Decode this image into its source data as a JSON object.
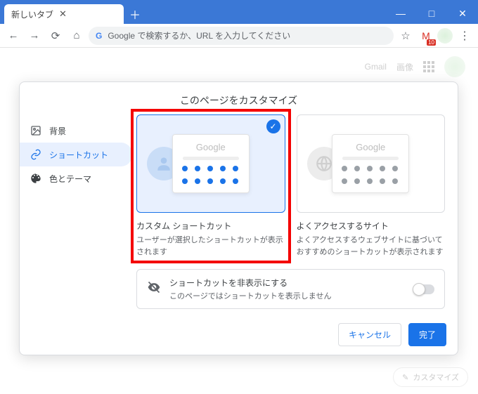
{
  "window": {
    "tab_title": "新しいタブ"
  },
  "toolbar": {
    "omnibox_placeholder": "Google で検索するか、URL を入力してください",
    "gmail_badge": "10"
  },
  "ntp": {
    "gmail": "Gmail",
    "images": "画像",
    "customize_fab": "カスタマイズ"
  },
  "dialog": {
    "title": "このページをカスタマイズ",
    "sidebar": {
      "background": "背景",
      "shortcuts": "ショートカット",
      "theme": "色とテーマ"
    },
    "cards": {
      "custom": {
        "logo": "Google",
        "title": "カスタム ショートカット",
        "desc": "ユーザーが選択したショートカットが表示されます"
      },
      "most": {
        "logo": "Google",
        "title": "よくアクセスするサイト",
        "desc": "よくアクセスするウェブサイトに基づいておすすめのショートカットが表示されます"
      }
    },
    "hide": {
      "title": "ショートカットを非表示にする",
      "desc": "このページではショートカットを表示しません"
    },
    "footer": {
      "cancel": "キャンセル",
      "done": "完了"
    }
  },
  "colors": {
    "dot_selected": "#1a73e8",
    "dot_grey": "#9aa0a6",
    "logo_grey": "#bdbdbd",
    "ghost_blue": "#c9ddf7",
    "ghost_grey": "#e4e4e4"
  }
}
